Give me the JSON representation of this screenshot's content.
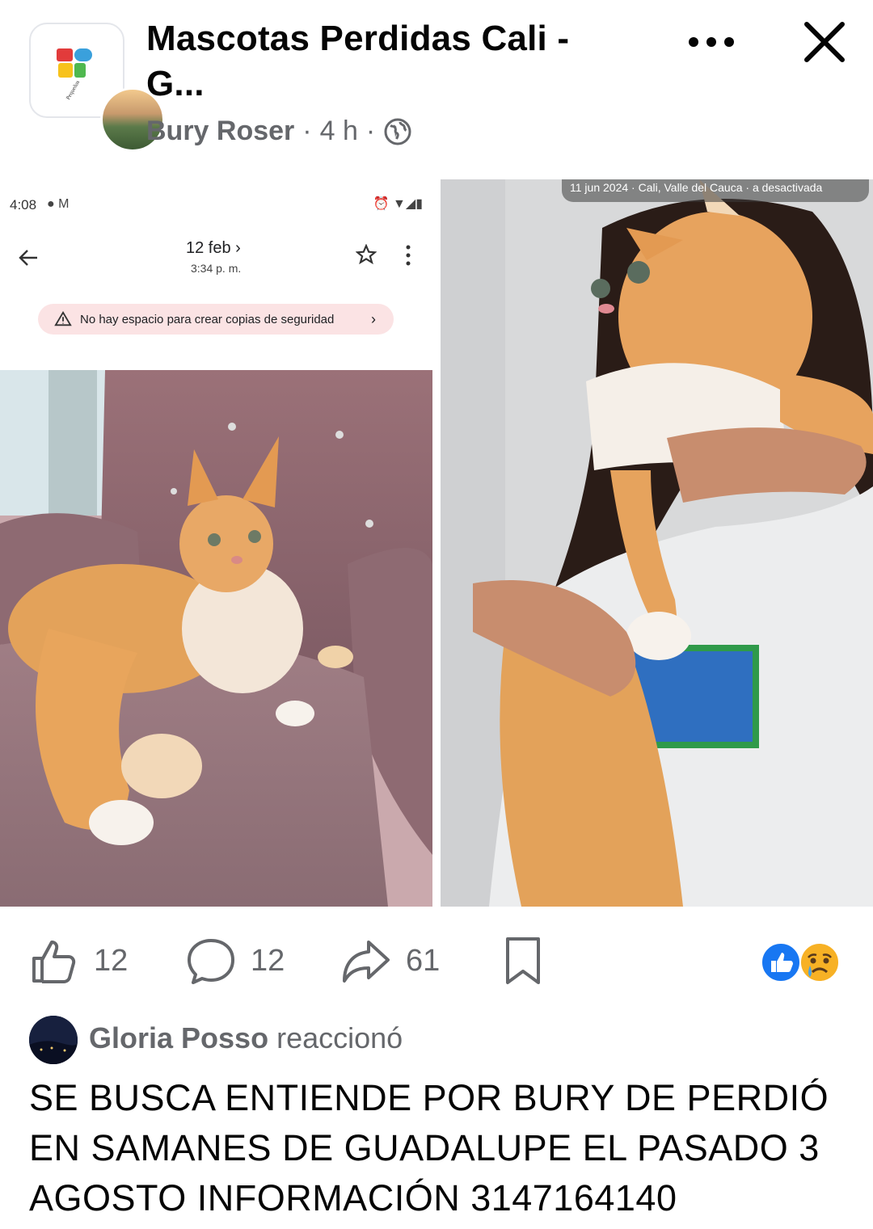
{
  "header": {
    "group_name": "Mascotas Perdidas Cali - G...",
    "author": "Bury Roser",
    "time_ago": "4 h",
    "separator": "·",
    "privacy_icon": "globe-icon",
    "more_icon": "more-horizontal-icon",
    "close_icon": "close-icon",
    "logo_text": "Pequeñas Acciones"
  },
  "photo_left": {
    "status_time": "4:08",
    "mail_date": "12 feb ›",
    "mail_time": "3:34 p. m.",
    "backup_banner": "No hay espacio para crear copias de seguridad",
    "chevron": "›"
  },
  "photo_right": {
    "caption": "11 jun 2024 · Cali, Valle del Cauca · a desactivada"
  },
  "actions": {
    "like_count": "12",
    "comment_count": "12",
    "share_count": "61",
    "like_icon": "thumbs-up-icon",
    "comment_icon": "comment-bubble-icon",
    "share_icon": "share-arrow-icon",
    "save_icon": "bookmark-icon",
    "reaction_icons": [
      "like-reaction-icon",
      "sad-reaction-icon"
    ]
  },
  "reaction_line": {
    "name": "Gloria Posso",
    "verb": "reaccionó"
  },
  "post": {
    "text": "SE BUSCA ENTIENDE POR BURY DE PERDIÓ EN SAMANES DE GUADALUPE EL PASADO 3 AGOSTO INFORMACIÓN 3147164140"
  },
  "colors": {
    "meta_gray": "#65676b",
    "text": "#050505",
    "like_blue": "#1877f2",
    "banner_pink": "#fbe3e4"
  }
}
